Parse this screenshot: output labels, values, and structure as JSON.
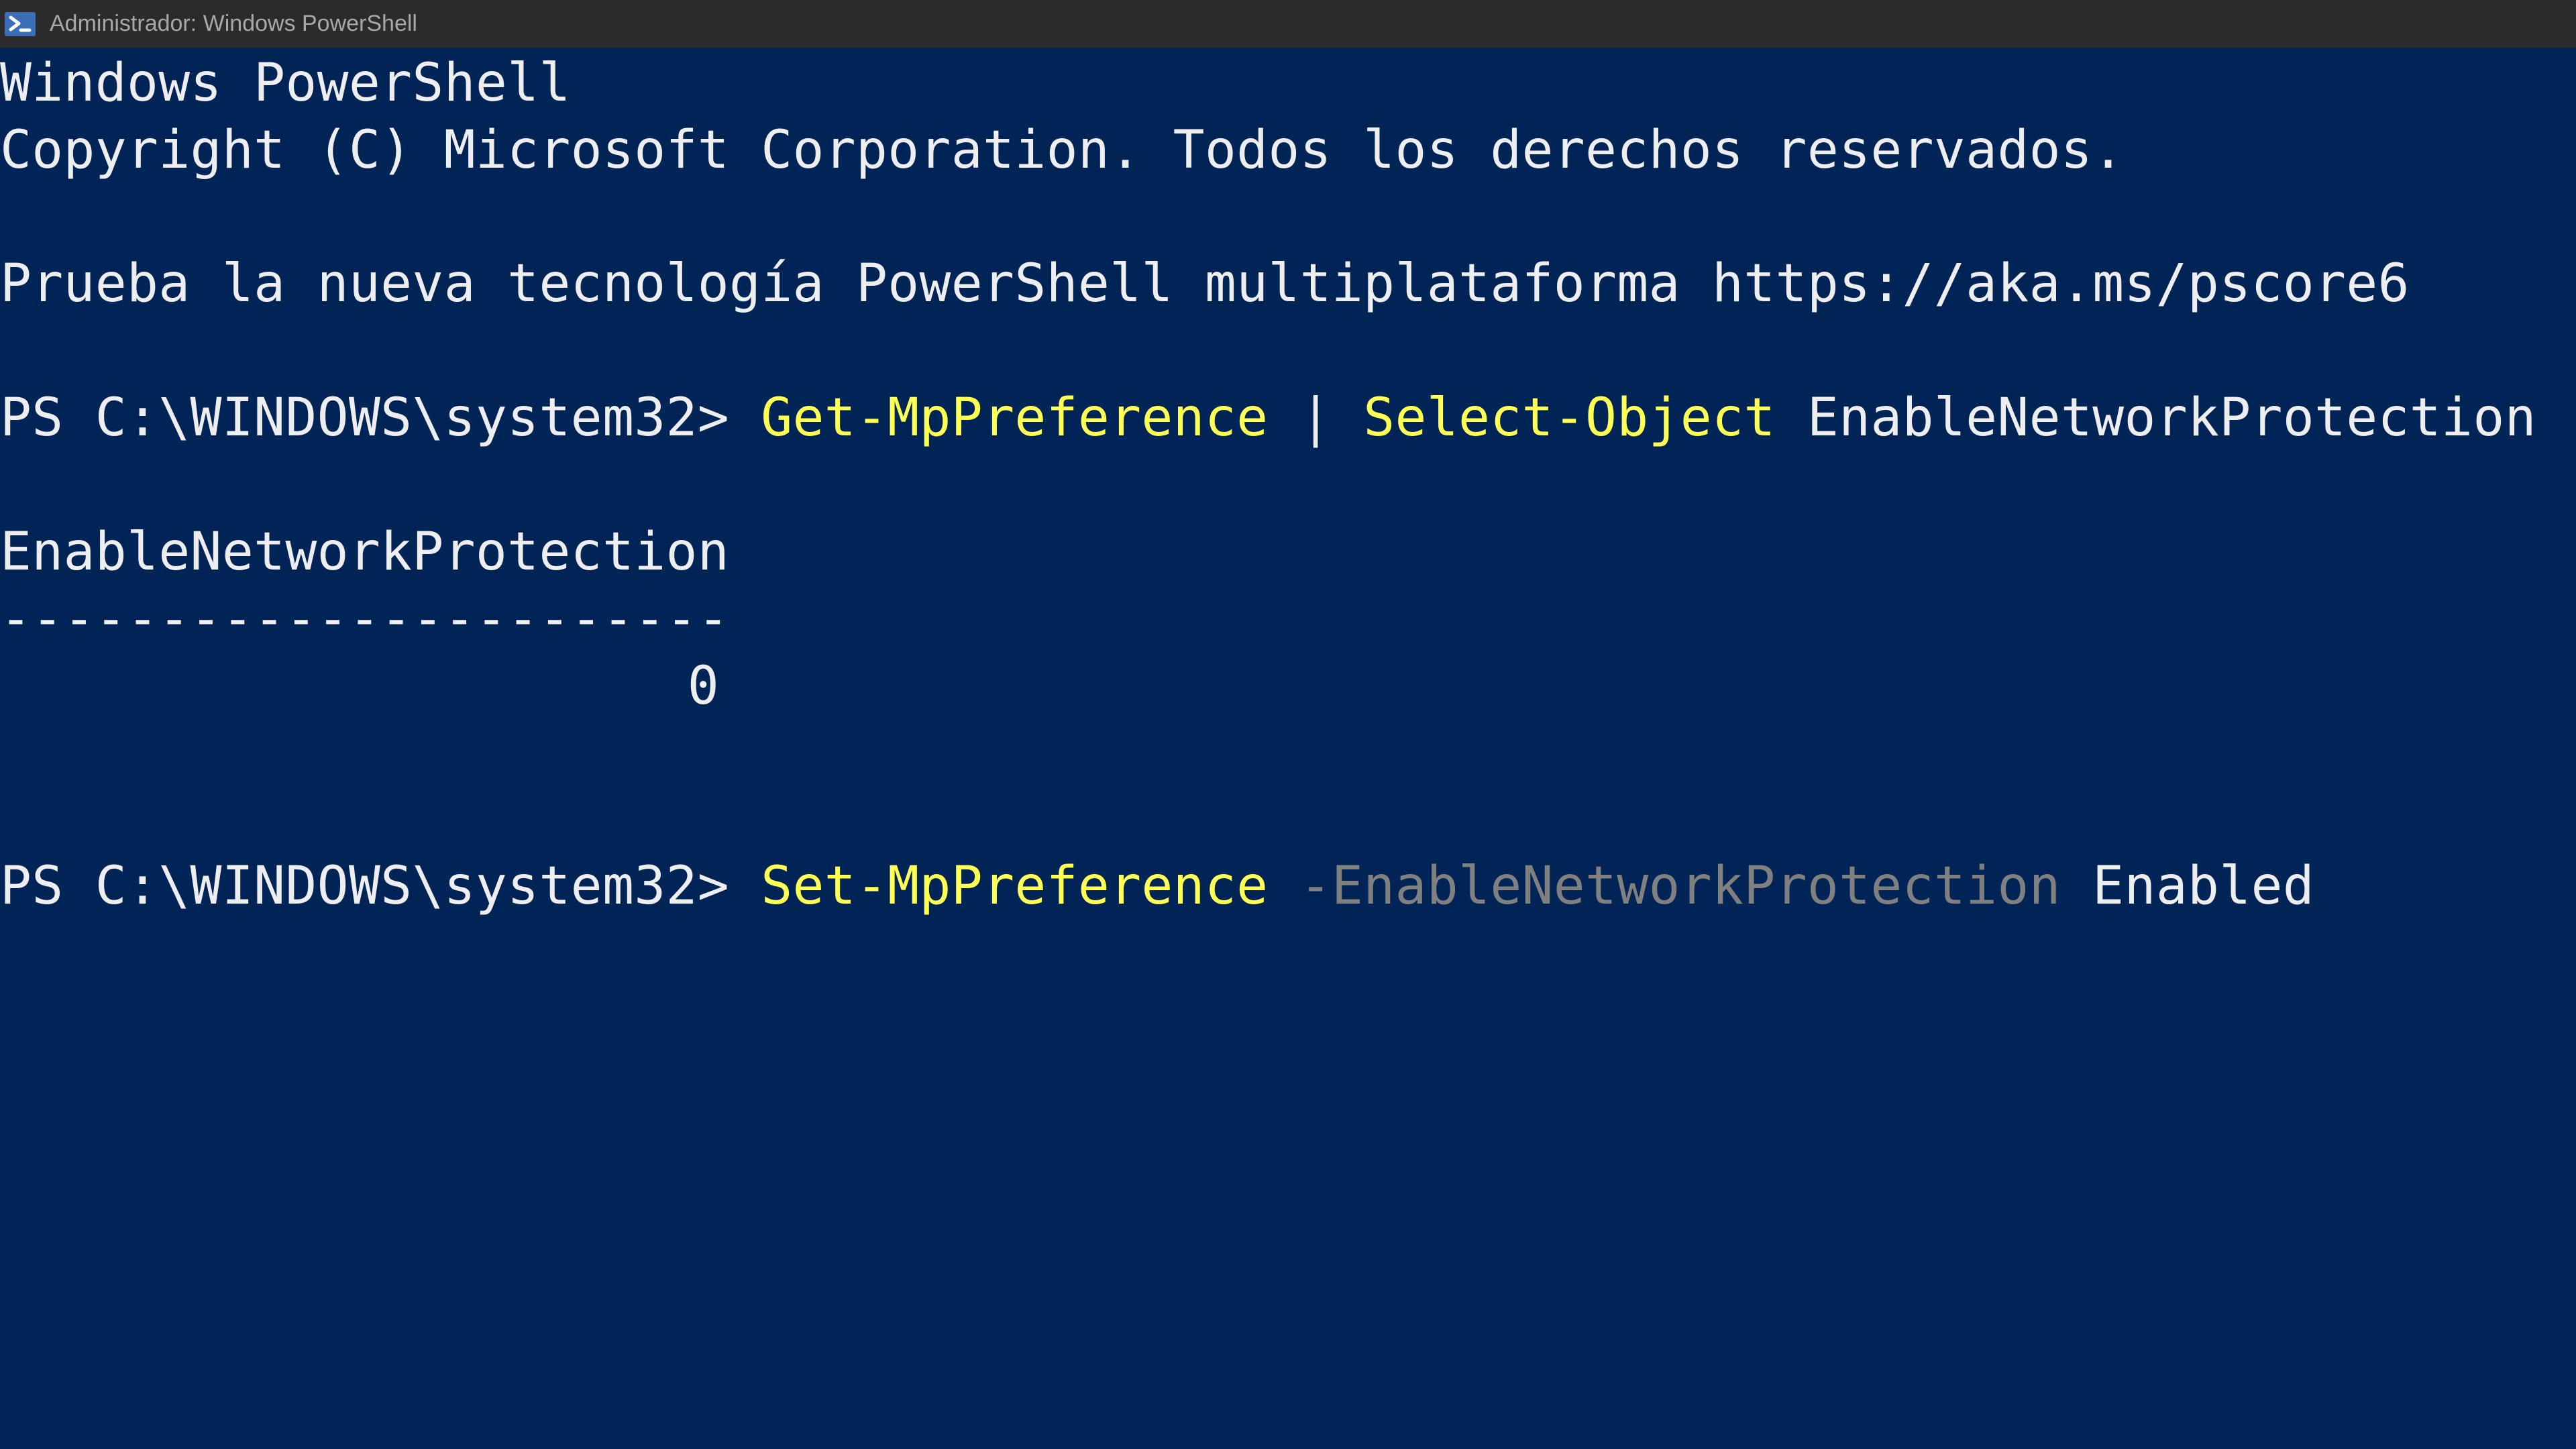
{
  "window": {
    "title": "Administrador: Windows PowerShell",
    "icon": "powershell-icon",
    "colors": {
      "background": "#012456",
      "titlebar": "#2b2b2b",
      "text": "#eeedf0",
      "command": "#ffff54",
      "parameter": "#808080"
    }
  },
  "console": {
    "banner_line1": "Windows PowerShell",
    "banner_line2": "Copyright (C) Microsoft Corporation. Todos los derechos reservados.",
    "banner_line3": "Prueba la nueva tecnología PowerShell multiplataforma https://aka.ms/pscore6",
    "cmd1": {
      "prompt": "PS C:\\WINDOWS\\system32> ",
      "command": "Get-MpPreference",
      "pipe": " | ",
      "command2": "Select-Object",
      "argument": " EnableNetworkProtection"
    },
    "output": {
      "header": "EnableNetworkProtection",
      "separator": "-----------------------",
      "value": "0"
    },
    "cmd2": {
      "prompt": "PS C:\\WINDOWS\\system32> ",
      "command": "Set-MpPreference",
      "parameter": " -EnableNetworkProtection",
      "argument": " Enabled"
    }
  }
}
